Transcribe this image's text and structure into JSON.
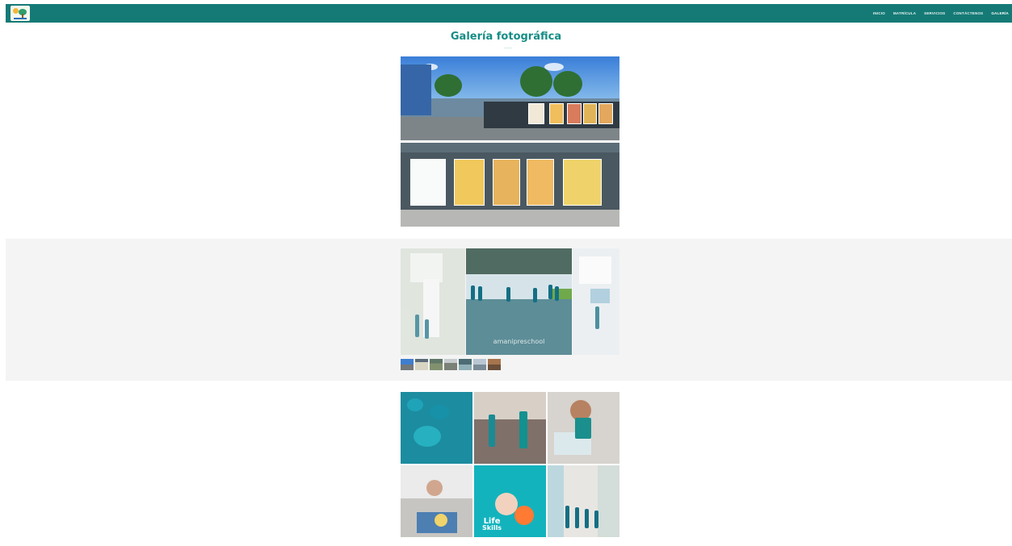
{
  "header": {
    "logo_icon": "preschool-logo",
    "menu": [
      {
        "label": "INICIO",
        "active": false
      },
      {
        "label": "MATRÍCULA",
        "active": false
      },
      {
        "label": "SERVICIOS",
        "active": false
      },
      {
        "label": "CONTÁCTENOS",
        "active": false
      },
      {
        "label": "GALERÍA",
        "active": true
      }
    ],
    "background_color": "#157a76"
  },
  "page": {
    "title": "Galería fotográfica",
    "title_color": "#168d86"
  },
  "carousel": {
    "watermark": "amanipreschool",
    "thumbnails": 7
  },
  "mosaic": {
    "badge_line1": "Life",
    "badge_line2": "Skills"
  }
}
